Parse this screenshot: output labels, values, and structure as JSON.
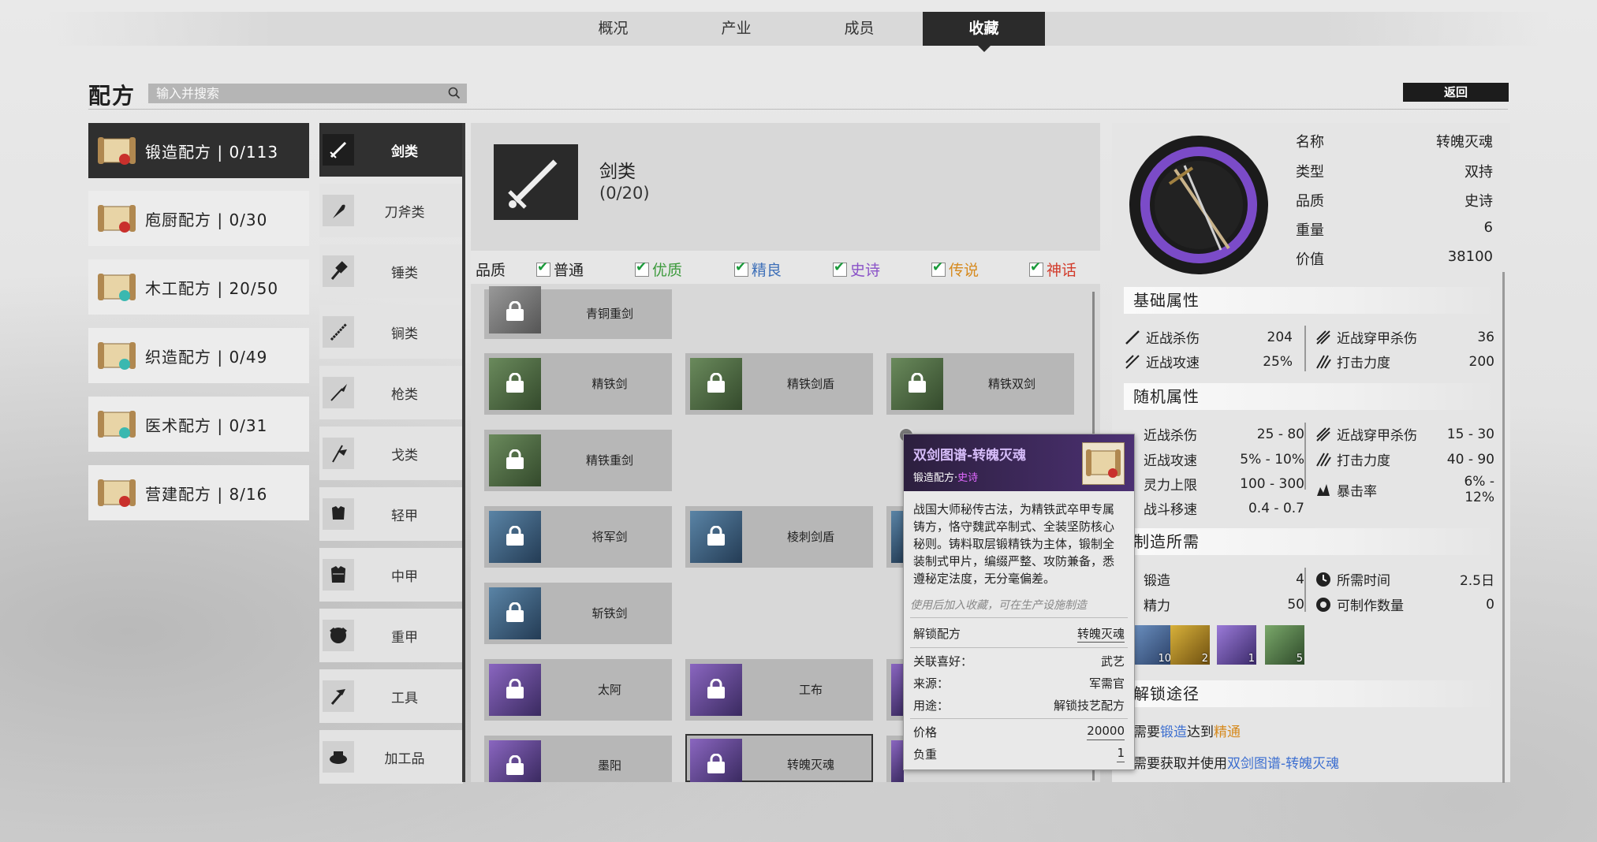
{
  "nav": {
    "tabs": [
      "概况",
      "产业",
      "成员",
      "收藏"
    ],
    "active_index": 3
  },
  "header": {
    "title": "配方",
    "search_placeholder": "输入并搜索",
    "back_label": "返回"
  },
  "categories": [
    {
      "label": "锻造配方 | 0/113",
      "active": true
    },
    {
      "label": "庖厨配方 | 0/30",
      "active": false
    },
    {
      "label": "木工配方 | 20/50",
      "active": false
    },
    {
      "label": "织造配方 | 0/49",
      "active": false
    },
    {
      "label": "医术配方 | 0/31",
      "active": false
    },
    {
      "label": "营建配方 | 8/16",
      "active": false
    }
  ],
  "weapon_types": [
    {
      "label": "剑类",
      "icon": "sword-icon",
      "active": true
    },
    {
      "label": "刀斧类",
      "icon": "blade-axe-icon",
      "active": false
    },
    {
      "label": "锤类",
      "icon": "hammer-icon",
      "active": false
    },
    {
      "label": "锏类",
      "icon": "mace-icon",
      "active": false
    },
    {
      "label": "枪类",
      "icon": "spear-icon",
      "active": false
    },
    {
      "label": "戈类",
      "icon": "halberd-icon",
      "active": false
    },
    {
      "label": "轻甲",
      "icon": "light-armor-icon",
      "active": false
    },
    {
      "label": "中甲",
      "icon": "medium-armor-icon",
      "active": false
    },
    {
      "label": "重甲",
      "icon": "heavy-armor-icon",
      "active": false
    },
    {
      "label": "工具",
      "icon": "tool-icon",
      "active": false
    },
    {
      "label": "加工品",
      "icon": "processed-goods-icon",
      "active": false
    }
  ],
  "middle": {
    "title": "剑类",
    "count": "(0/20)",
    "quality_label": "品质",
    "qualities": [
      {
        "label": "普通",
        "color": "#222222"
      },
      {
        "label": "优质",
        "color": "#3c9a3c"
      },
      {
        "label": "精良",
        "color": "#3d6fb8"
      },
      {
        "label": "史诗",
        "color": "#8a52c8"
      },
      {
        "label": "传说",
        "color": "#d68a1e"
      },
      {
        "label": "神话",
        "color": "#d23b2b"
      }
    ],
    "items": [
      {
        "name": "青铜重剑",
        "tier": "gray"
      },
      {
        "name": "精铁剑",
        "tier": "green"
      },
      {
        "name": "精铁剑盾",
        "tier": "green"
      },
      {
        "name": "精铁双剑",
        "tier": "green"
      },
      {
        "name": "精铁重剑",
        "tier": "green"
      },
      {
        "name": "将军剑",
        "tier": "blue"
      },
      {
        "name": "棱刺剑盾",
        "tier": "blue"
      },
      {
        "name": "斩铁剑",
        "tier": "blue"
      },
      {
        "name": "太阿",
        "tier": "purple"
      },
      {
        "name": "工布",
        "tier": "purple"
      },
      {
        "name": "墨阳",
        "tier": "purple"
      },
      {
        "name": "转魄灭魂",
        "tier": "purple"
      }
    ]
  },
  "tooltip": {
    "name": "双剑图谱-转魄灭魂",
    "subtitle_prefix": "锻造配方·",
    "subtitle_quality": "史诗",
    "description": "战国大师秘传古法，为精铁武卒甲专属铸方，恪守魏武卒制式、全装坚防核心秘则。铸料取层锻精铁为主体，锻制全装制式甲片，编缀严整、攻防兼备，悉遵秘定法度，无分毫偏差。",
    "hint": "使用后加入收藏，可在生产设施制造",
    "unlock_label": "解锁配方",
    "unlock_value": "转魄灭魂",
    "pref_label": "关联喜好：",
    "pref_value": "武艺",
    "source_label": "来源：",
    "source_value": "军需官",
    "use_label": "用途：",
    "use_value": "解锁技艺配方",
    "price_label": "价格",
    "price_value": "20000",
    "weight_label": "负重",
    "weight_value": "1"
  },
  "detail": {
    "info": [
      {
        "k": "名称",
        "v": "转魄灭魂"
      },
      {
        "k": "类型",
        "v": "双持"
      },
      {
        "k": "品质",
        "v": "史诗"
      },
      {
        "k": "重量",
        "v": "6"
      },
      {
        "k": "价值",
        "v": "38100"
      }
    ],
    "base_title": "基础属性",
    "base_stats": [
      {
        "name": "近战杀伤",
        "value": "204"
      },
      {
        "name": "近战穿甲杀伤",
        "value": "36"
      },
      {
        "name": "近战攻速",
        "value": "25%"
      },
      {
        "name": "打击力度",
        "value": "200"
      }
    ],
    "random_title": "随机属性",
    "random_stats": [
      {
        "name": "近战杀伤",
        "value": "25 - 80"
      },
      {
        "name": "近战穿甲杀伤",
        "value": "15 - 30"
      },
      {
        "name": "近战攻速",
        "value": "5% - 10%"
      },
      {
        "name": "打击力度",
        "value": "40 - 90"
      },
      {
        "name": "灵力上限",
        "value": "100 - 300"
      },
      {
        "name": "暴击率",
        "value": "6% - 12%"
      },
      {
        "name": "战斗移速",
        "value": "0.4 - 0.7"
      }
    ],
    "craft_title": "制造所需",
    "craft_stats": [
      {
        "name": "锻造",
        "value": "4"
      },
      {
        "name": "所需时间",
        "value": "2.5日"
      },
      {
        "name": "精力",
        "value": "50"
      },
      {
        "name": "可制作数量",
        "value": "0"
      }
    ],
    "materials": [
      {
        "icon": "iron-ingot-icon",
        "count": "10"
      },
      {
        "icon": "gold-ingot-icon",
        "count": "2"
      },
      {
        "icon": "crystal-ore-icon",
        "count": "1"
      },
      {
        "icon": "silver-plate-icon",
        "count": "5"
      }
    ],
    "unlock_title": "解锁途径",
    "unlock_line1": {
      "a": "需要",
      "b": "锻造",
      "c": "达到",
      "d": "精通"
    },
    "unlock_line2": {
      "a": "需要获取并使用",
      "b": "双剑图谱-转魄灭魂"
    }
  }
}
